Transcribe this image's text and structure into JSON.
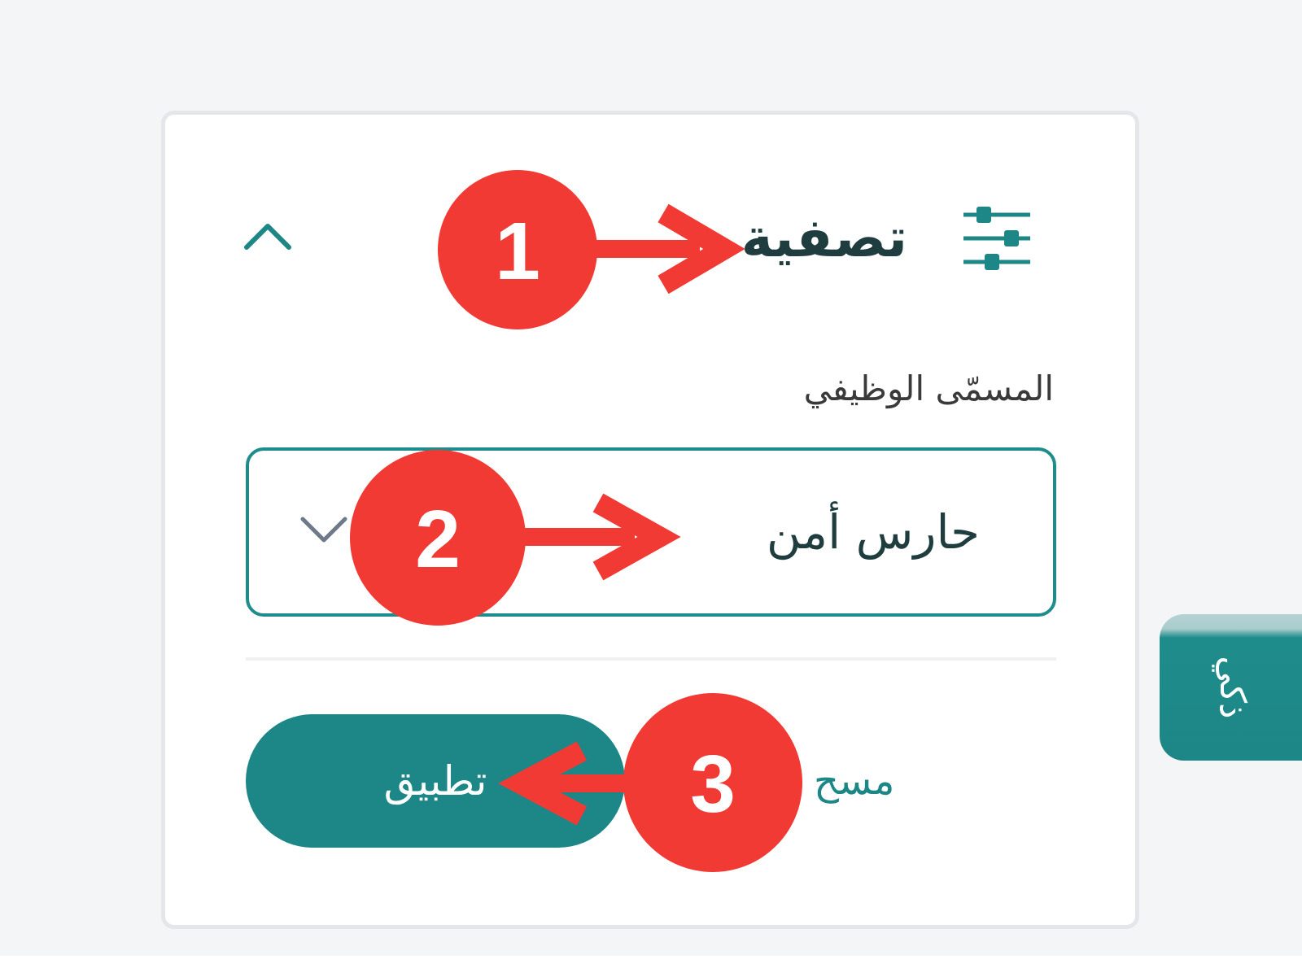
{
  "filter_panel": {
    "title": "تصفية",
    "field_label": "المسمّى الوظيفي",
    "selected_value": "حارس أمن",
    "apply_label": "تطبيق",
    "clear_label": "مسح",
    "icons": {
      "filter": "sliders-icon",
      "collapse": "chevron-up-icon",
      "dropdown": "chevron-down-icon"
    }
  },
  "side_tab": {
    "label": "ذكي"
  },
  "annotations": [
    {
      "number": "1"
    },
    {
      "number": "2"
    },
    {
      "number": "3"
    }
  ],
  "colors": {
    "accent": "#1d8686",
    "title_text": "#1f3d3e",
    "callout_red": "#f23a35",
    "page_background": "#f4f5f7"
  }
}
